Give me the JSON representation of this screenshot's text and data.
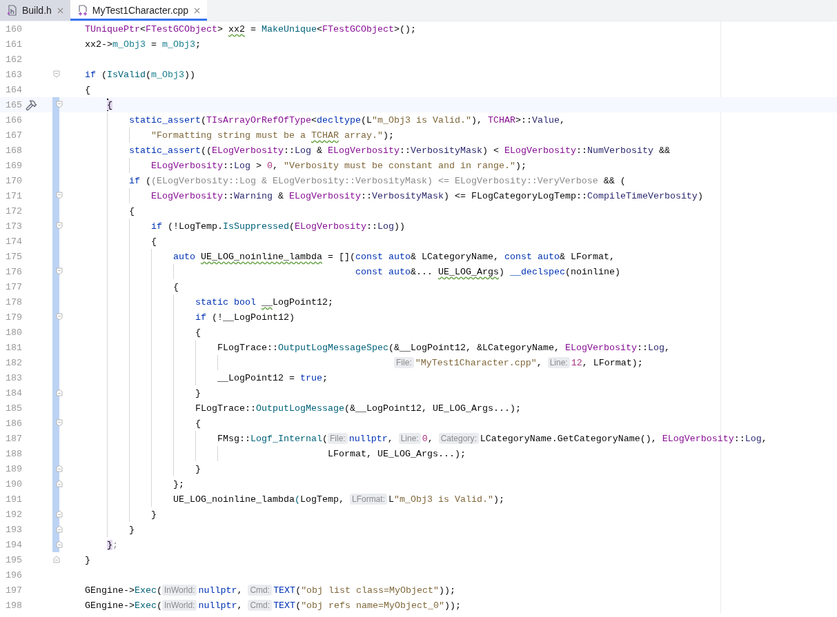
{
  "tabs": [
    {
      "label": "Build.h",
      "kind": "header",
      "selected": false
    },
    {
      "label": "MyTest1Character.cpp",
      "kind": "source",
      "selected": true
    }
  ],
  "lines": [
    {
      "number": "160",
      "changed": false,
      "current": false,
      "marker": false,
      "parts": [
        {
          "text": "    TUniquePtr",
          "kind": "type"
        },
        {
          "text": "<",
          "kind": "plain"
        },
        {
          "text": "FTestGCObject",
          "kind": "type"
        },
        {
          "text": "> ",
          "kind": "plain"
        },
        {
          "text": "xx2",
          "kind": "plain",
          "squiggle": true
        },
        {
          "text": " = ",
          "kind": "plain"
        },
        {
          "text": "MakeUnique",
          "kind": "fn"
        },
        {
          "text": "<",
          "kind": "plain"
        },
        {
          "text": "FTestGCObject",
          "kind": "type"
        },
        {
          "text": ">();",
          "kind": "plain"
        }
      ]
    },
    {
      "number": "161",
      "changed": false,
      "current": false,
      "marker": false,
      "parts": [
        {
          "text": "    xx2->",
          "kind": "plain"
        },
        {
          "text": "m_Obj3",
          "kind": "field"
        },
        {
          "text": " = ",
          "kind": "plain"
        },
        {
          "text": "m_Obj3",
          "kind": "field"
        },
        {
          "text": ";",
          "kind": "plain"
        }
      ]
    },
    {
      "number": "162",
      "changed": false,
      "current": false,
      "marker": false
    },
    {
      "number": "163",
      "fold": {
        "kind": "open"
      },
      "changed": false,
      "current": false,
      "marker": false,
      "parts": [
        {
          "text": "    if",
          "kind": "kw"
        },
        {
          "text": " (",
          "kind": "plain"
        },
        {
          "text": "IsValid",
          "kind": "fn"
        },
        {
          "text": "(",
          "kind": "plain"
        },
        {
          "text": "m_Obj3",
          "kind": "field"
        },
        {
          "text": "))",
          "kind": "plain"
        }
      ]
    },
    {
      "number": "164",
      "changed": false,
      "current": false,
      "marker": false,
      "parts": [
        {
          "text": "    {",
          "kind": "plain"
        }
      ]
    },
    {
      "number": "165",
      "fold": {
        "kind": "open"
      },
      "changed": true,
      "current": true,
      "marker": true,
      "parts": [
        {
          "text": "        {",
          "kind": "brace"
        }
      ]
    },
    {
      "number": "166",
      "changed": true,
      "current": false,
      "marker": false,
      "parts": [
        {
          "text": "            static_assert",
          "kind": "kw"
        },
        {
          "text": "(",
          "kind": "plain"
        },
        {
          "text": "TIsArrayOrRefOfType",
          "kind": "type"
        },
        {
          "text": "<",
          "kind": "plain"
        },
        {
          "text": "decltype",
          "kind": "kw"
        },
        {
          "text": "(L",
          "kind": "plain"
        },
        {
          "text": "\"m_Obj3 is Valid.\"",
          "kind": "str"
        },
        {
          "text": "), ",
          "kind": "plain"
        },
        {
          "text": "TCHAR",
          "kind": "type"
        },
        {
          "text": ">::",
          "kind": "plain"
        },
        {
          "text": "Value",
          "kind": "enum"
        },
        {
          "text": ",",
          "kind": "plain"
        }
      ]
    },
    {
      "number": "167",
      "changed": true,
      "current": false,
      "marker": false,
      "parts": [
        {
          "text": "                \"Formatting string must be a ",
          "kind": "str"
        },
        {
          "text": "TCHAR",
          "kind": "str",
          "squiggle": true
        },
        {
          "text": " array.\"",
          "kind": "str"
        },
        {
          "text": ");",
          "kind": "plain"
        }
      ]
    },
    {
      "number": "168",
      "changed": true,
      "current": false,
      "marker": false,
      "parts": [
        {
          "text": "            static_assert",
          "kind": "kw"
        },
        {
          "text": "((",
          "kind": "plain"
        },
        {
          "text": "ELogVerbosity",
          "kind": "type"
        },
        {
          "text": "::",
          "kind": "plain"
        },
        {
          "text": "Log",
          "kind": "enum"
        },
        {
          "text": " & ",
          "kind": "plain"
        },
        {
          "text": "ELogVerbosity",
          "kind": "type"
        },
        {
          "text": "::",
          "kind": "plain"
        },
        {
          "text": "VerbosityMask",
          "kind": "enum"
        },
        {
          "text": ") < ",
          "kind": "plain"
        },
        {
          "text": "ELogVerbosity",
          "kind": "type"
        },
        {
          "text": "::",
          "kind": "plain"
        },
        {
          "text": "NumVerbosity",
          "kind": "enum"
        },
        {
          "text": " &&",
          "kind": "plain"
        }
      ]
    },
    {
      "number": "169",
      "changed": true,
      "current": false,
      "marker": false,
      "parts": [
        {
          "text": "                ELogVerbosity",
          "kind": "type"
        },
        {
          "text": "::",
          "kind": "plain"
        },
        {
          "text": "Log",
          "kind": "enum"
        },
        {
          "text": " > ",
          "kind": "plain"
        },
        {
          "text": "0",
          "kind": "num"
        },
        {
          "text": ", ",
          "kind": "plain"
        },
        {
          "text": "\"Verbosity must be constant and in range.\"",
          "kind": "str"
        },
        {
          "text": ");",
          "kind": "plain"
        }
      ]
    },
    {
      "number": "170",
      "changed": true,
      "current": false,
      "marker": false,
      "parts": [
        {
          "text": "            if",
          "kind": "kw"
        },
        {
          "text": " (",
          "kind": "plain"
        },
        {
          "text": "(ELogVerbosity::Log & ELogVerbosity::VerbosityMask) <= ELogVerbosity::VeryVerbose",
          "kind": "dim"
        },
        {
          "text": " && (",
          "kind": "plain"
        }
      ]
    },
    {
      "number": "171",
      "fold": {
        "kind": "open"
      },
      "changed": true,
      "current": false,
      "marker": false,
      "parts": [
        {
          "text": "                ELogVerbosity",
          "kind": "type"
        },
        {
          "text": "::",
          "kind": "plain"
        },
        {
          "text": "Warning",
          "kind": "enum"
        },
        {
          "text": " & ",
          "kind": "plain"
        },
        {
          "text": "ELogVerbosity",
          "kind": "type"
        },
        {
          "text": "::",
          "kind": "plain"
        },
        {
          "text": "VerbosityMask",
          "kind": "enum"
        },
        {
          "text": ") <= FLogCategoryLogTemp::",
          "kind": "plain"
        },
        {
          "text": "CompileTimeVerbosity",
          "kind": "enum"
        },
        {
          "text": ")",
          "kind": "plain"
        }
      ]
    },
    {
      "number": "172",
      "changed": true,
      "current": false,
      "marker": false,
      "parts": [
        {
          "text": "            {",
          "kind": "plain"
        }
      ]
    },
    {
      "number": "173",
      "fold": {
        "kind": "open"
      },
      "changed": true,
      "current": false,
      "marker": false,
      "parts": [
        {
          "text": "                if",
          "kind": "kw"
        },
        {
          "text": " (!LogTemp.",
          "kind": "plain"
        },
        {
          "text": "IsSuppressed",
          "kind": "fn"
        },
        {
          "text": "(",
          "kind": "plain"
        },
        {
          "text": "ELogVerbosity",
          "kind": "type"
        },
        {
          "text": "::",
          "kind": "plain"
        },
        {
          "text": "Log",
          "kind": "enum"
        },
        {
          "text": "))",
          "kind": "plain"
        }
      ]
    },
    {
      "number": "174",
      "changed": true,
      "current": false,
      "marker": false,
      "parts": [
        {
          "text": "                {",
          "kind": "plain"
        }
      ]
    },
    {
      "number": "175",
      "changed": true,
      "current": false,
      "marker": false,
      "parts": [
        {
          "text": "                    auto ",
          "kind": "kw"
        },
        {
          "text": "UE_LOG_noinline_lambda",
          "kind": "plain",
          "squiggle": true
        },
        {
          "text": " = [](",
          "kind": "plain"
        },
        {
          "text": "const auto",
          "kind": "kw"
        },
        {
          "text": "& LCategoryName, ",
          "kind": "plain"
        },
        {
          "text": "const auto",
          "kind": "kw"
        },
        {
          "text": "& LFormat,",
          "kind": "plain"
        }
      ]
    },
    {
      "number": "176",
      "fold": {
        "kind": "open"
      },
      "changed": true,
      "current": false,
      "marker": false,
      "parts": [
        {
          "text": "                                                     const auto",
          "kind": "kw"
        },
        {
          "text": "&... ",
          "kind": "plain"
        },
        {
          "text": "UE_LOG_Args",
          "kind": "plain",
          "squiggle": true
        },
        {
          "text": ") ",
          "kind": "plain"
        },
        {
          "text": "__declspec",
          "kind": "kw"
        },
        {
          "text": "(noinline)",
          "kind": "plain"
        }
      ]
    },
    {
      "number": "177",
      "changed": true,
      "current": false,
      "marker": false,
      "parts": [
        {
          "text": "                    {",
          "kind": "plain"
        }
      ]
    },
    {
      "number": "178",
      "changed": true,
      "current": false,
      "marker": false,
      "parts": [
        {
          "text": "                        static bool ",
          "kind": "kw"
        },
        {
          "text": "__",
          "kind": "plain",
          "squiggle": true
        },
        {
          "text": "LogPoint12;",
          "kind": "plain"
        }
      ]
    },
    {
      "number": "179",
      "fold": {
        "kind": "open"
      },
      "changed": true,
      "current": false,
      "marker": false,
      "parts": [
        {
          "text": "                        if",
          "kind": "kw"
        },
        {
          "text": " (!__LogPoint12)",
          "kind": "plain"
        }
      ]
    },
    {
      "number": "180",
      "changed": true,
      "current": false,
      "marker": false,
      "parts": [
        {
          "text": "                        {",
          "kind": "plain"
        }
      ]
    },
    {
      "number": "181",
      "changed": true,
      "current": false,
      "marker": false,
      "parts": [
        {
          "text": "                            FLogTrace::",
          "kind": "plain"
        },
        {
          "text": "OutputLogMessageSpec",
          "kind": "fn"
        },
        {
          "text": "(&__LogPoint12, &LCategoryName, ",
          "kind": "plain"
        },
        {
          "text": "ELogVerbosity",
          "kind": "type"
        },
        {
          "text": "::",
          "kind": "plain"
        },
        {
          "text": "Log",
          "kind": "enum"
        },
        {
          "text": ",",
          "kind": "plain"
        }
      ]
    },
    {
      "number": "182",
      "changed": true,
      "current": false,
      "marker": false,
      "parts": [
        {
          "text": "                                                            File:",
          "kind": "hint"
        },
        {
          "text": "\"MyTest1Character.cpp\"",
          "kind": "str"
        },
        {
          "text": ", ",
          "kind": "plain"
        },
        {
          "text": "Line:",
          "kind": "hint"
        },
        {
          "text": "12",
          "kind": "num"
        },
        {
          "text": ", LFormat);",
          "kind": "plain"
        }
      ]
    },
    {
      "number": "183",
      "changed": true,
      "current": false,
      "marker": false,
      "parts": [
        {
          "text": "                            __LogPoint12 = ",
          "kind": "plain"
        },
        {
          "text": "true",
          "kind": "kw"
        },
        {
          "text": ";",
          "kind": "plain"
        }
      ]
    },
    {
      "number": "184",
      "fold": {
        "kind": "close"
      },
      "changed": true,
      "current": false,
      "marker": false,
      "parts": [
        {
          "text": "                        }",
          "kind": "plain"
        }
      ]
    },
    {
      "number": "185",
      "changed": true,
      "current": false,
      "marker": false,
      "parts": [
        {
          "text": "                        FLogTrace::",
          "kind": "plain"
        },
        {
          "text": "OutputLogMessage",
          "kind": "fn"
        },
        {
          "text": "(&__LogPoint12, UE_LOG_Args...);",
          "kind": "plain"
        }
      ]
    },
    {
      "number": "186",
      "fold": {
        "kind": "open"
      },
      "changed": true,
      "current": false,
      "marker": false,
      "parts": [
        {
          "text": "                        {",
          "kind": "plain"
        }
      ]
    },
    {
      "number": "187",
      "changed": true,
      "current": false,
      "marker": false,
      "parts": [
        {
          "text": "                            FMsg::",
          "kind": "plain"
        },
        {
          "text": "Logf_Internal",
          "kind": "fn"
        },
        {
          "text": "(",
          "kind": "plain"
        },
        {
          "text": "File:",
          "kind": "hint"
        },
        {
          "text": "nullptr",
          "kind": "kw"
        },
        {
          "text": ", ",
          "kind": "plain"
        },
        {
          "text": "Line:",
          "kind": "hint"
        },
        {
          "text": "0",
          "kind": "num"
        },
        {
          "text": ", ",
          "kind": "plain"
        },
        {
          "text": "Category:",
          "kind": "hint"
        },
        {
          "text": "LCategoryName.GetCategoryName(), ",
          "kind": "plain"
        },
        {
          "text": "ELogVerbosity",
          "kind": "type"
        },
        {
          "text": "::",
          "kind": "plain"
        },
        {
          "text": "Log",
          "kind": "enum"
        },
        {
          "text": ",",
          "kind": "plain"
        }
      ]
    },
    {
      "number": "188",
      "changed": true,
      "current": false,
      "marker": false,
      "parts": [
        {
          "text": "                                                LFormat, UE_LOG_Args...);",
          "kind": "plain"
        }
      ]
    },
    {
      "number": "189",
      "fold": {
        "kind": "close"
      },
      "changed": true,
      "current": false,
      "marker": false,
      "parts": [
        {
          "text": "                        }",
          "kind": "plain"
        }
      ]
    },
    {
      "number": "190",
      "fold": {
        "kind": "close"
      },
      "changed": true,
      "current": false,
      "marker": false,
      "parts": [
        {
          "text": "                    };",
          "kind": "plain"
        }
      ]
    },
    {
      "number": "191",
      "changed": true,
      "current": false,
      "marker": false,
      "parts": [
        {
          "text": "                    UE_LOG_noinline_lambda",
          "kind": "plain"
        },
        {
          "text": "(",
          "kind": "fn"
        },
        {
          "text": "LogTemp, ",
          "kind": "plain"
        },
        {
          "text": "LFormat:",
          "kind": "hint"
        },
        {
          "text": "L",
          "kind": "plain"
        },
        {
          "text": "\"m_Obj3 is Valid.\"",
          "kind": "str"
        },
        {
          "text": ");",
          "kind": "plain"
        }
      ]
    },
    {
      "number": "192",
      "fold": {
        "kind": "close"
      },
      "changed": true,
      "current": false,
      "marker": false,
      "parts": [
        {
          "text": "                }",
          "kind": "plain"
        }
      ]
    },
    {
      "number": "193",
      "fold": {
        "kind": "close"
      },
      "changed": true,
      "current": false,
      "marker": false,
      "parts": [
        {
          "text": "            }",
          "kind": "plain"
        }
      ]
    },
    {
      "number": "194",
      "fold": {
        "kind": "close"
      },
      "changed": true,
      "current": false,
      "marker": false,
      "parts": [
        {
          "text": "        }",
          "kind": "brace"
        },
        {
          "text": ";",
          "kind": "dim"
        }
      ]
    },
    {
      "number": "195",
      "fold": {
        "kind": "close"
      },
      "changed": false,
      "current": false,
      "marker": false,
      "parts": [
        {
          "text": "    }",
          "kind": "plain"
        }
      ]
    },
    {
      "number": "196",
      "changed": false,
      "current": false,
      "marker": false
    },
    {
      "number": "197",
      "changed": false,
      "current": false,
      "marker": false,
      "parts": [
        {
          "text": "    GEngine->",
          "kind": "plain"
        },
        {
          "text": "Exec",
          "kind": "fn"
        },
        {
          "text": "(",
          "kind": "plain"
        },
        {
          "text": "InWorld:",
          "kind": "hint"
        },
        {
          "text": "nullptr",
          "kind": "kw"
        },
        {
          "text": ", ",
          "kind": "plain"
        },
        {
          "text": "Cmd:",
          "kind": "hint"
        },
        {
          "text": "TEXT",
          "kind": "kw"
        },
        {
          "text": "(",
          "kind": "plain"
        },
        {
          "text": "\"obj list class=MyObject\"",
          "kind": "str"
        },
        {
          "text": "));",
          "kind": "plain"
        }
      ]
    },
    {
      "number": "198",
      "changed": false,
      "current": false,
      "marker": false,
      "parts": [
        {
          "text": "    GEngine->",
          "kind": "plain"
        },
        {
          "text": "Exec",
          "kind": "fn"
        },
        {
          "text": "(",
          "kind": "plain"
        },
        {
          "text": "InWorld:",
          "kind": "hint"
        },
        {
          "text": "nullptr",
          "kind": "kw"
        },
        {
          "text": ", ",
          "kind": "plain"
        },
        {
          "text": "Cmd:",
          "kind": "hint"
        },
        {
          "text": "TEXT",
          "kind": "kw"
        },
        {
          "text": "(",
          "kind": "plain"
        },
        {
          "text": "\"obj refs name=MyObject_0\"",
          "kind": "str"
        },
        {
          "text": "));",
          "kind": "plain"
        }
      ]
    }
  ]
}
